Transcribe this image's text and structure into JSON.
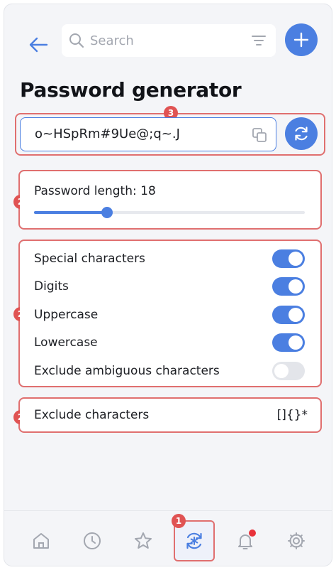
{
  "header": {
    "search_placeholder": "Search"
  },
  "page": {
    "title": "Password generator"
  },
  "password": {
    "value": "o~HSpRm#9Ue@;q~.J"
  },
  "length": {
    "label": "Password length: 18",
    "value": 18,
    "fill_fraction": 0.27
  },
  "options": [
    {
      "label": "Special characters",
      "enabled": true
    },
    {
      "label": "Digits",
      "enabled": true
    },
    {
      "label": "Uppercase",
      "enabled": true
    },
    {
      "label": "Lowercase",
      "enabled": true
    },
    {
      "label": "Exclude ambiguous characters",
      "enabled": false
    }
  ],
  "exclude": {
    "label": "Exclude characters",
    "value": "[]{}*"
  },
  "badges": {
    "password_row": "3",
    "length_card": "2",
    "options_card": "2",
    "exclude_card": "2",
    "nav_generator": "1"
  },
  "nav": {
    "items": [
      "home-icon",
      "history-icon",
      "star-icon",
      "generator-icon",
      "bell-icon",
      "gear-icon"
    ],
    "active": "generator-icon",
    "notification_dot": true
  },
  "colors": {
    "accent": "#4b7fe1",
    "highlight": "#e06f6f",
    "badge": "#e05353",
    "notification": "#e8323a"
  }
}
